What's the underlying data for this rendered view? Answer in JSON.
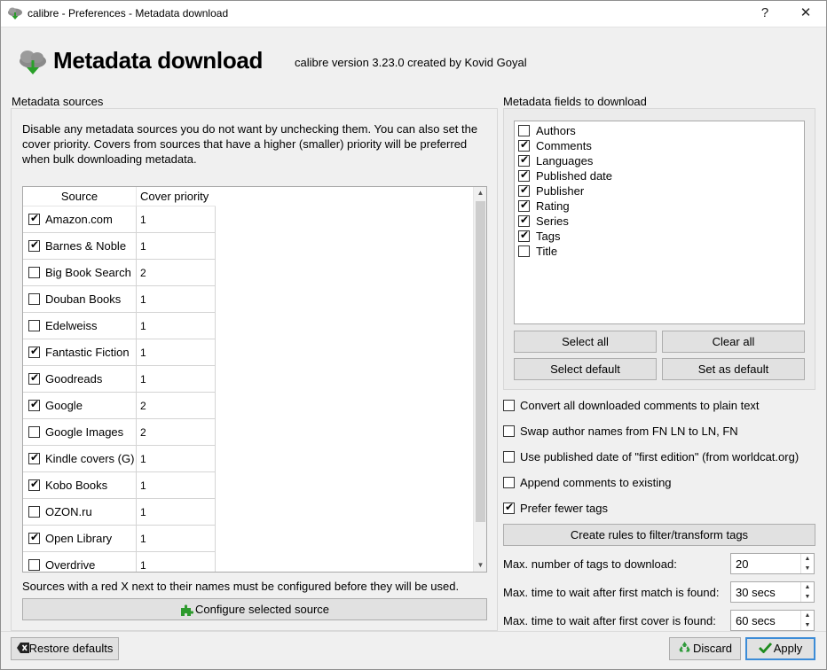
{
  "window": {
    "title": "calibre - Preferences - Metadata download",
    "help_glyph": "?",
    "close_glyph": "✕",
    "app_icon": "calibre-download-icon"
  },
  "header": {
    "title": "Metadata download",
    "version": "calibre version 3.23.0 created by Kovid Goyal",
    "icon": "metadata-download-icon"
  },
  "sources_group": {
    "title": "Metadata sources",
    "description": "Disable any metadata sources you do not want by unchecking them. You can also set the cover priority. Covers from sources that have a higher (smaller) priority will be preferred when bulk downloading metadata.",
    "columns": [
      "Source",
      "Cover priority"
    ],
    "rows": [
      {
        "name": "Amazon.com",
        "checked": true,
        "priority": "1"
      },
      {
        "name": "Barnes & Noble",
        "checked": true,
        "priority": "1"
      },
      {
        "name": "Big Book Search",
        "checked": false,
        "priority": "2"
      },
      {
        "name": "Douban Books",
        "checked": false,
        "priority": "1"
      },
      {
        "name": "Edelweiss",
        "checked": false,
        "priority": "1"
      },
      {
        "name": "Fantastic Fiction",
        "checked": true,
        "priority": "1"
      },
      {
        "name": "Goodreads",
        "checked": true,
        "priority": "1"
      },
      {
        "name": "Google",
        "checked": true,
        "priority": "2"
      },
      {
        "name": "Google Images",
        "checked": false,
        "priority": "2"
      },
      {
        "name": "Kindle covers (G)",
        "checked": true,
        "priority": "1"
      },
      {
        "name": "Kobo Books",
        "checked": true,
        "priority": "1"
      },
      {
        "name": "OZON.ru",
        "checked": false,
        "priority": "1"
      },
      {
        "name": "Open Library",
        "checked": true,
        "priority": "1"
      },
      {
        "name": "Overdrive",
        "checked": false,
        "priority": "1"
      }
    ],
    "note": "Sources with a red X next to their names must be configured before they will be used.",
    "configure_button": "Configure selected source",
    "configure_icon": "puzzle-piece-icon"
  },
  "fields_group": {
    "title": "Metadata fields to download",
    "fields": [
      {
        "name": "Authors",
        "checked": false
      },
      {
        "name": "Comments",
        "checked": true
      },
      {
        "name": "Languages",
        "checked": true
      },
      {
        "name": "Published date",
        "checked": true
      },
      {
        "name": "Publisher",
        "checked": true
      },
      {
        "name": "Rating",
        "checked": true
      },
      {
        "name": "Series",
        "checked": true
      },
      {
        "name": "Tags",
        "checked": true
      },
      {
        "name": "Title",
        "checked": false
      }
    ],
    "buttons": {
      "select_all": "Select all",
      "clear_all": "Clear all",
      "select_default": "Select default",
      "set_as_default": "Set as default"
    }
  },
  "options": [
    {
      "label": "Convert all downloaded comments to plain text",
      "checked": false
    },
    {
      "label": "Swap author names from FN LN to LN, FN",
      "checked": false
    },
    {
      "label": "Use published date of \"first edition\" (from worldcat.org)",
      "checked": false
    },
    {
      "label": "Append comments to existing",
      "checked": false
    },
    {
      "label": "Prefer fewer tags",
      "checked": true
    }
  ],
  "rules_button": "Create rules to filter/transform tags",
  "spinners": [
    {
      "label": "Max. number of tags to download:",
      "value": "20"
    },
    {
      "label": "Max. time to wait after first match is found:",
      "value": "30 secs"
    },
    {
      "label": "Max. time to wait after first cover is found:",
      "value": "60 secs"
    }
  ],
  "footer": {
    "restore_defaults": "Restore defaults",
    "discard": "Discard",
    "apply": "Apply"
  },
  "colors": {
    "accent": "#3c8cd7",
    "apply_check": "#1e8b1e",
    "discard_icon": "#2e9a3a",
    "puzzle": "#2e9a2e"
  }
}
